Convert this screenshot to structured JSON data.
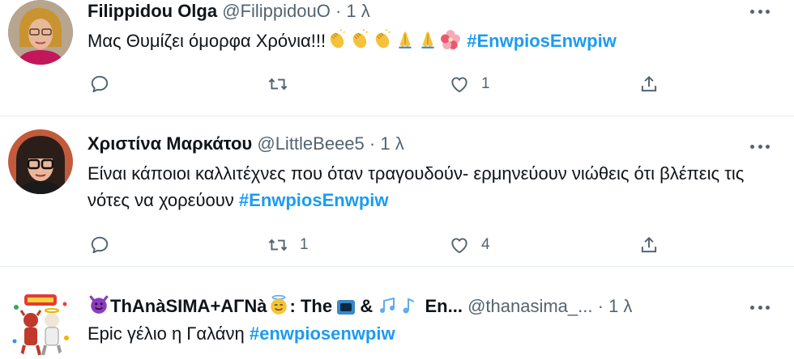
{
  "tweets": [
    {
      "name": "Filippidou Olga",
      "handle": "@FilippidouO",
      "separator": "·",
      "time": "1 λ",
      "text": "Μας Θυμίζει όμορφα Χρόνια!!!",
      "emojis": [
        "clapping-hands",
        "clapping-hands",
        "clapping-hands",
        "folded-hands",
        "folded-hands",
        "hibiscus"
      ],
      "hashtag": "#EnwpiosEnwpiw",
      "actions": {
        "replies": "",
        "retweets": "",
        "likes": "1"
      }
    },
    {
      "name": "Χριστίνα Μαρκάτου",
      "handle": "@LittleBeee5",
      "separator": "·",
      "time": "1 λ",
      "text": "Είναι κάποιοι καλλιτέχνες που όταν τραγουδούν- ερμηνεύουν νιώθεις ότι βλέπεις τις νότες να χορεύουν",
      "hashtag": "#EnwpiosEnwpiw",
      "actions": {
        "replies": "",
        "retweets": "1",
        "likes": "4"
      }
    },
    {
      "name_parts": [
        "ThAnàSIMA+ΑΓΝà",
        ": The",
        "&",
        "En..."
      ],
      "name_emojis": [
        "smiling-devil",
        "smiling-halo",
        "television",
        "musical-notes",
        "musical-note"
      ],
      "handle": "@thanasima_...",
      "separator": "·",
      "time": "1 λ",
      "text": "Epic γέλιο η Γαλάνη",
      "hashtag": "#enwpiosenwpiw"
    }
  ],
  "colors": {
    "hashtag": "#1d9bf0",
    "muted": "#536471",
    "text": "#0f1419",
    "divider": "#e6ecf0"
  },
  "icons": [
    "reply-icon",
    "retweet-icon",
    "like-icon",
    "share-icon",
    "more-options-icon"
  ]
}
